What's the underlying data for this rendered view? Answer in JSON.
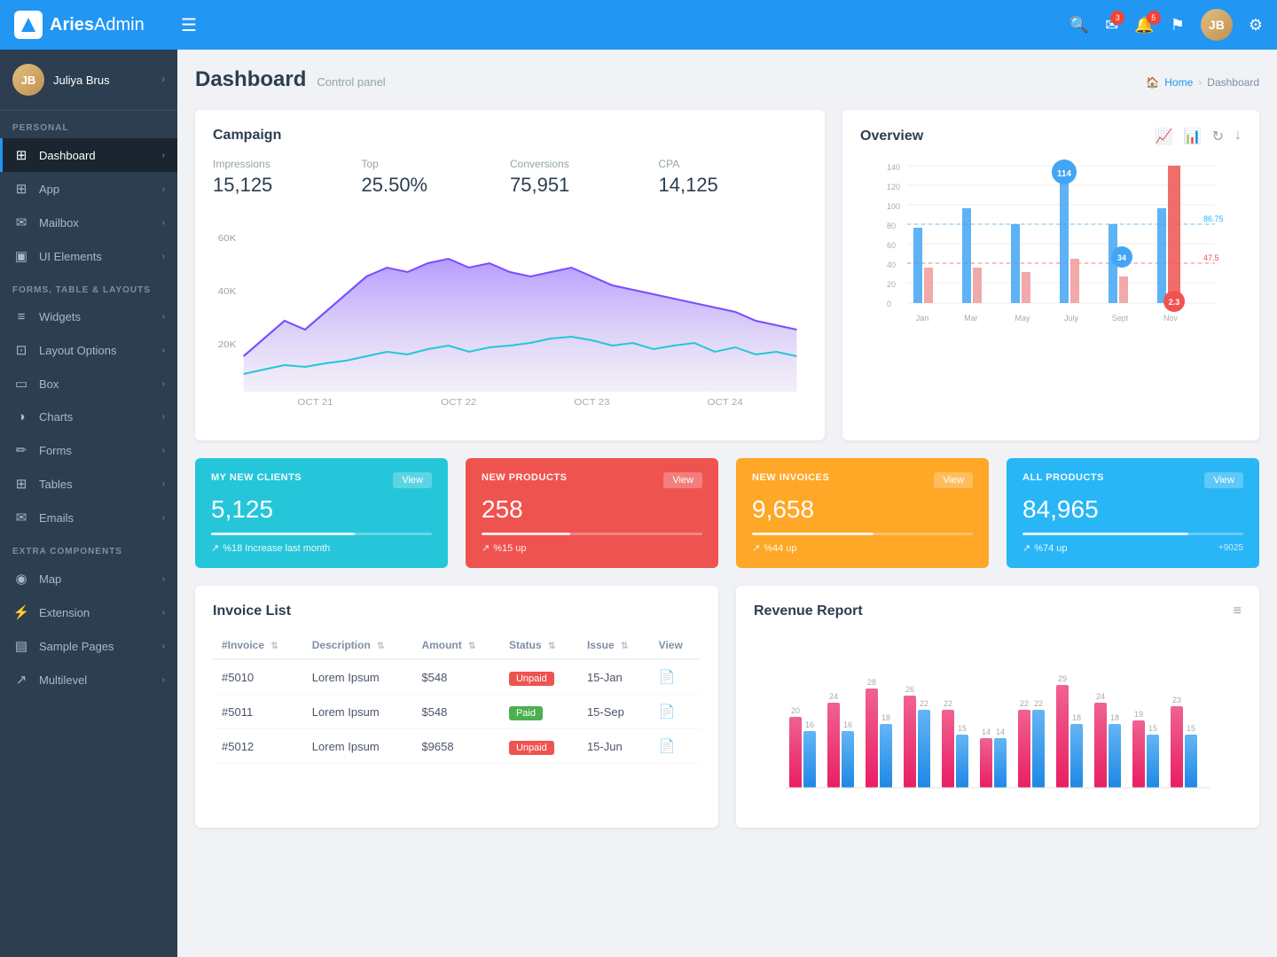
{
  "app": {
    "name": "Aries",
    "nameAdmin": "Admin",
    "hamburger": "☰"
  },
  "topnav": {
    "icons": {
      "search": "🔍",
      "mail": "✉",
      "mail_badge": "3",
      "bell": "🔔",
      "bell_badge": "5",
      "flag": "⚑",
      "settings": "⚙"
    }
  },
  "sidebar": {
    "user": {
      "name": "Juliya Brus",
      "initials": "JB"
    },
    "sections": [
      {
        "label": "PERSONAL",
        "items": [
          {
            "icon": "⊞",
            "label": "Dashboard",
            "active": true
          },
          {
            "icon": "⊞",
            "label": "App",
            "active": false
          },
          {
            "icon": "✉",
            "label": "Mailbox",
            "active": false
          },
          {
            "icon": "▣",
            "label": "UI Elements",
            "active": false
          }
        ]
      },
      {
        "label": "FORMS, TABLE & LAYOUTS",
        "items": [
          {
            "icon": "≡",
            "label": "Widgets",
            "active": false
          },
          {
            "icon": "⊡",
            "label": "Layout Options",
            "active": false
          },
          {
            "icon": "▭",
            "label": "Box",
            "active": false
          },
          {
            "icon": "◑",
            "label": "Charts",
            "active": false
          },
          {
            "icon": "✏",
            "label": "Forms",
            "active": false
          },
          {
            "icon": "⊞",
            "label": "Tables",
            "active": false
          },
          {
            "icon": "✉",
            "label": "Emails",
            "active": false
          }
        ]
      },
      {
        "label": "EXTRA COMPONENTS",
        "items": [
          {
            "icon": "◉",
            "label": "Map",
            "active": false
          },
          {
            "icon": "⚡",
            "label": "Extension",
            "active": false
          },
          {
            "icon": "▤",
            "label": "Sample Pages",
            "active": false
          },
          {
            "icon": "↗",
            "label": "Multilevel",
            "active": false
          }
        ]
      }
    ]
  },
  "page": {
    "title": "Dashboard",
    "subtitle": "Control panel",
    "breadcrumb": [
      "Home",
      "Dashboard"
    ]
  },
  "campaign": {
    "title": "Campaign",
    "stats": [
      {
        "label": "Impressions",
        "value": "15,125"
      },
      {
        "label": "Top",
        "value": "25.50%"
      },
      {
        "label": "Conversions",
        "value": "75,951"
      },
      {
        "label": "CPA",
        "value": "14,125"
      }
    ],
    "chart_dates": [
      "OCT 21",
      "OCT 22",
      "OCT 23",
      "OCT 24"
    ],
    "y_labels": [
      "60K",
      "40K",
      "20K"
    ]
  },
  "overview": {
    "title": "Overview",
    "x_labels": [
      "Jan",
      "Mar",
      "May",
      "July",
      "Sept",
      "Nov"
    ],
    "y_labels": [
      "140",
      "120",
      "100",
      "80",
      "60",
      "40",
      "20",
      "0"
    ],
    "annotations": [
      {
        "value": "114",
        "color": "#2196F3"
      },
      {
        "value": "86.75",
        "color": "#29B6F6"
      },
      {
        "value": "34",
        "color": "#2196F3"
      },
      {
        "value": "47.5",
        "color": "#29B6F6"
      },
      {
        "value": "2.3",
        "color": "#EF5350"
      }
    ]
  },
  "stat_cards": [
    {
      "label": "MY NEW CLIENTS",
      "value": "5,125",
      "view": "View",
      "bar_pct": 65,
      "footer": "%18 Increase last month",
      "color": "green"
    },
    {
      "label": "NEW PRODUCTS",
      "value": "258",
      "view": "View",
      "bar_pct": 40,
      "footer": "%15 up",
      "color": "red"
    },
    {
      "label": "NEW INVOICES",
      "value": "9,658",
      "view": "View",
      "bar_pct": 55,
      "footer": "%44 up",
      "color": "amber"
    },
    {
      "label": "ALL PRODUCTS",
      "value": "84,965",
      "view": "View",
      "bar_pct": 75,
      "footer": "%74 up",
      "extra": "+9025",
      "color": "blue"
    }
  ],
  "invoice_list": {
    "title": "Invoice List",
    "columns": [
      "#Invoice",
      "Description",
      "Amount",
      "Status",
      "Issue",
      "View"
    ],
    "rows": [
      {
        "invoice": "#5010",
        "desc": "Lorem Ipsum",
        "amount": "$548",
        "status": "Unpaid",
        "issue": "15-Jan",
        "status_type": "unpaid"
      },
      {
        "invoice": "#5011",
        "desc": "Lorem Ipsum",
        "amount": "$548",
        "status": "Paid",
        "issue": "15-Sep",
        "status_type": "paid"
      },
      {
        "invoice": "#5012",
        "desc": "Lorem Ipsum",
        "amount": "$9658",
        "status": "Unpaid",
        "issue": "15-Jun",
        "status_type": "unpaid"
      }
    ]
  },
  "revenue_report": {
    "title": "Revenue Report",
    "bar_data": [
      {
        "pink": 20,
        "blue": 16
      },
      {
        "pink": 24,
        "blue": 16
      },
      {
        "pink": 28,
        "blue": 18
      },
      {
        "pink": 26,
        "blue": 22
      },
      {
        "pink": 22,
        "blue": 15
      },
      {
        "pink": 14,
        "blue": 14
      },
      {
        "pink": 22,
        "blue": 22
      },
      {
        "pink": 29,
        "blue": 18
      },
      {
        "pink": 24,
        "blue": 18
      },
      {
        "pink": 19,
        "blue": 15
      },
      {
        "pink": 23,
        "blue": 15
      }
    ]
  }
}
